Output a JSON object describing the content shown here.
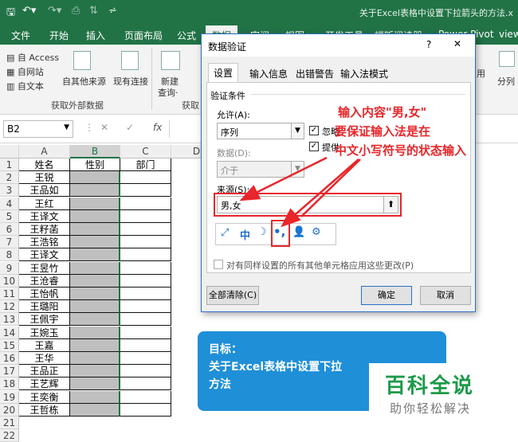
{
  "window": {
    "doc_title": "关于Excel表格中设置下拉箭头的方法.x",
    "qa_icons": [
      "save-icon",
      "undo-icon",
      "redo-icon",
      "print-preview-icon",
      "sort-icon",
      "customize-icon"
    ]
  },
  "tabs": [
    "文件",
    "开始",
    "插入",
    "页面布局",
    "公式",
    "数据",
    "审阅",
    "视图",
    "开发工具",
    "福昕阅读器",
    "Power Pivot",
    "view"
  ],
  "ribbon": {
    "access": "自 Access",
    "web": "自网站",
    "text": "自文本",
    "other_sources": "自其他来源",
    "existing": "现有连接",
    "new_query": "新建",
    "query": "查询·",
    "group_external": "获取外部数据",
    "group_get": "获取",
    "apply": "用",
    "split": "分列"
  },
  "formula_bar": {
    "name_box": "B2",
    "fx": "fx"
  },
  "sheet": {
    "columns": [
      "A",
      "B",
      "C",
      "D"
    ],
    "rows": [
      "1",
      "2",
      "3",
      "4",
      "5",
      "6",
      "7",
      "8",
      "9",
      "10",
      "11",
      "12",
      "13",
      "14",
      "15",
      "16",
      "17",
      "18",
      "19",
      "20",
      "21",
      "22"
    ],
    "header_row": [
      "姓名",
      "性别",
      "部门"
    ],
    "names": [
      "王锐",
      "王品如",
      "王红",
      "王译文",
      "王籽菡",
      "王浩铭",
      "王译文",
      "王昱竹",
      "王沧睿",
      "王怡帆",
      "王璐阳",
      "王佩宇",
      "王婉玉",
      "王嘉",
      "王华",
      "王品正",
      "王艺辉",
      "王奕衡",
      "王哲栋"
    ]
  },
  "dialog": {
    "title": "数据验证",
    "help": "?",
    "close": "✕",
    "tabs": [
      "设置",
      "输入信息",
      "出错警告",
      "输入法模式"
    ],
    "section": "验证条件",
    "allow_label": "允许(A):",
    "allow_value": "序列",
    "ignore_blank": "忽略",
    "dropdown": "提供",
    "data_label": "数据(D):",
    "data_value": "介于",
    "source_label": "来源(S):",
    "source_value": "男,女",
    "apply_all": "对有同样设置的所有其他单元格应用这些更改(P)",
    "clear_all": "全部清除(C)",
    "ok": "确定",
    "cancel": "取消"
  },
  "ime_bar": {
    "items": [
      "ime-switch-icon",
      "中",
      "half-width-moon-icon",
      "punctuation-icon",
      "user-icon",
      "gear-icon"
    ]
  },
  "annotation": {
    "line1": "输入内容\"男,女\"",
    "line2": "要保证输入法是在",
    "line3": "中文小写符号的状态输入"
  },
  "goal": {
    "label": "目标：",
    "line1": "关于Excel表格中设置下拉",
    "line2": "方法"
  },
  "logo": {
    "title": "百科全说",
    "subtitle": "助你轻松解决"
  }
}
